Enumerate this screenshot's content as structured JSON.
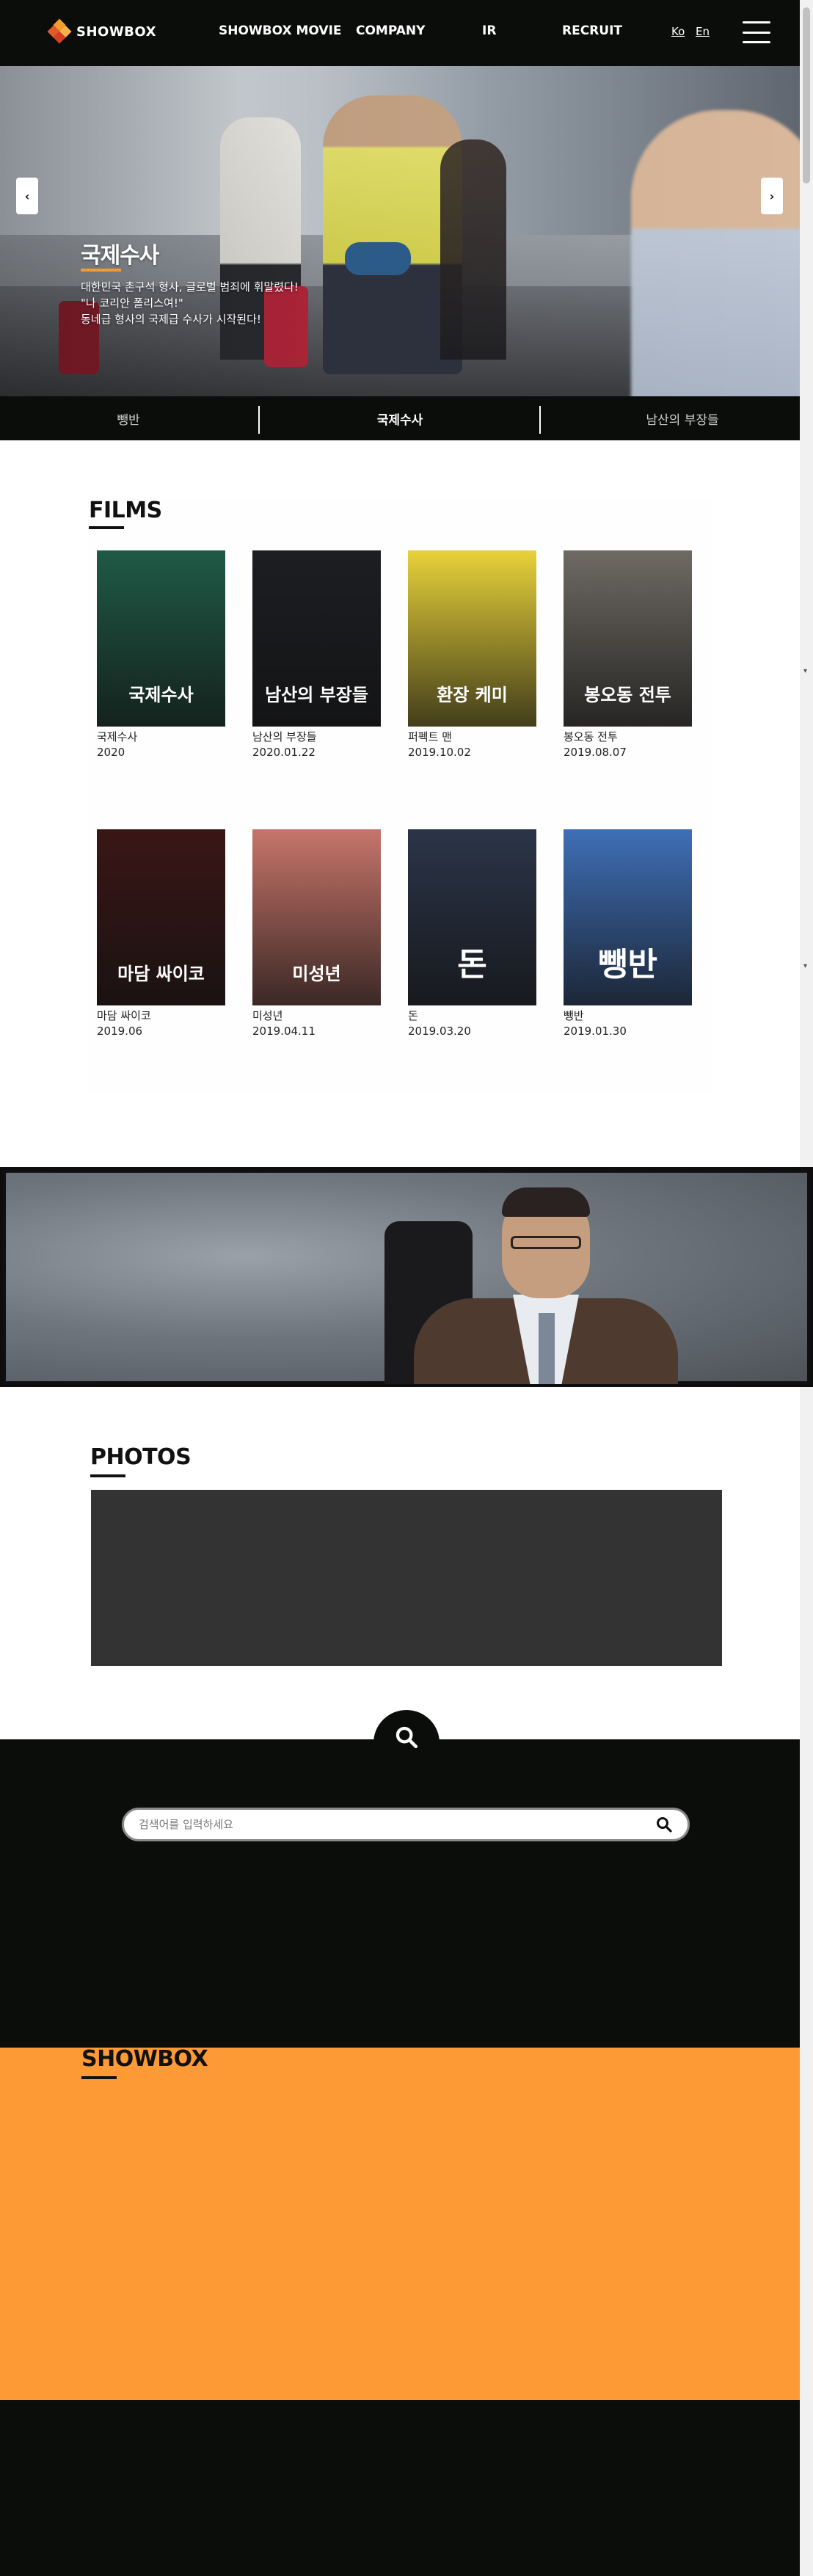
{
  "header": {
    "logo_text": "SHOWBOX",
    "nav": [
      "SHOWBOX MOVIE",
      "COMPANY",
      "IR",
      "RECRUIT"
    ],
    "lang": [
      "Ko",
      "En"
    ]
  },
  "hero": {
    "title": "국제수사",
    "description": [
      "대한민국 촌구석 형사, 글로벌 범죄에 휘말렸다!",
      "\"나 코리안 폴리스여!\"",
      "동네급 형사의 국제급 수사가 시작된다!"
    ],
    "prev_glyph": "‹",
    "next_glyph": "›"
  },
  "tabs": [
    "뺑반",
    "국제수사",
    "남산의 부장들"
  ],
  "films": {
    "section_title": "FILMS",
    "items": [
      {
        "title": "국제수사",
        "date": "2020",
        "poster_text": "국제수사",
        "color": "#1f5a46"
      },
      {
        "title": "남산의 부장들",
        "date": "2020.01.22",
        "poster_text": "남산의 부장들",
        "color": "#1c1e22"
      },
      {
        "title": "퍼펙트 맨",
        "date": "2019.10.02",
        "poster_text": "환장 케미",
        "color": "#e8d23a"
      },
      {
        "title": "봉오동 전투",
        "date": "2019.08.07",
        "poster_text": "봉오동 전투",
        "color": "#6e6a63"
      },
      {
        "title": "마담 싸이코",
        "date": "2019.06",
        "poster_text": "마담 싸이코",
        "color": "#3a1616"
      },
      {
        "title": "미성년",
        "date": "2019.04.11",
        "poster_text": "미성년",
        "color": "#c7756a"
      },
      {
        "title": "돈",
        "date": "2019.03.20",
        "poster_text": "돈",
        "color": "#2b3548"
      },
      {
        "title": "뺑반",
        "date": "2019.01.30",
        "poster_text": "뺑반",
        "color": "#3f6fb6"
      }
    ]
  },
  "photos": {
    "section_title": "PHOTOS"
  },
  "search": {
    "placeholder": "검색어를 입력하세요"
  },
  "footer": {
    "title": "SHOWBOX"
  },
  "colors": {
    "accent": "#f59a2e",
    "dark": "#0b0d0b",
    "orange": "#fe9a35"
  }
}
